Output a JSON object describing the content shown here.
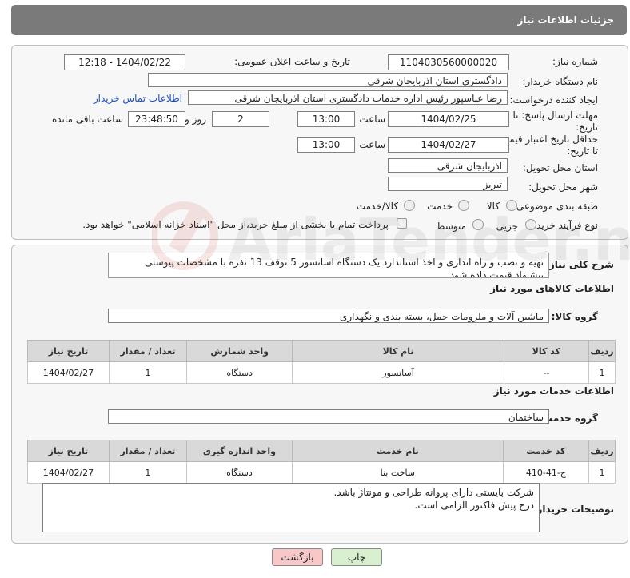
{
  "header": {
    "title": "جزئیات اطلاعات نیاز"
  },
  "fields": {
    "need_number_label": "شماره نیاز:",
    "need_number": "1104030560000020",
    "announce_label": "تاریخ و ساعت اعلان عمومی:",
    "announce_value": "1404/02/22 - 12:18",
    "buyer_org_label": "نام دستگاه خریدار:",
    "buyer_org": "دادگستری استان اذربایجان شرقی",
    "creator_label": "ایجاد کننده درخواست:",
    "creator": "رضا عباسپور رئیس اداره خدمات دادگستری استان اذربایجان شرقی",
    "contact_link": "اطلاعات تماس خریدار",
    "deadline_label": "مهلت ارسال پاسخ: تا تاریخ:",
    "deadline_date": "1404/02/25",
    "time_label": "ساعت",
    "deadline_time": "13:00",
    "days_value": "2",
    "days_label": "روز و",
    "remaining_time": "23:48:50",
    "remaining_label": "ساعت باقی مانده",
    "validity_label": "حداقل تاریخ اعتبار قیمت: تا تاریخ:",
    "validity_date": "1404/02/27",
    "validity_time": "13:00",
    "province_label": "استان محل تحویل:",
    "province": "آذربایجان شرقی",
    "city_label": "شهر محل تحویل:",
    "city": "تبریز",
    "category_label": "طبقه بندی موضوعی:",
    "category_options": [
      "کالا",
      "خدمت",
      "کالا/خدمت"
    ],
    "process_label": "نوع فرآیند خرید :",
    "process_options": [
      "جزیی",
      "متوسط"
    ],
    "payment_note": "پرداخت تمام یا بخشی از مبلغ خرید،از محل \"اسناد خزانه اسلامی\" خواهد بود."
  },
  "description": {
    "label": "شرح کلی نیاز:",
    "text": "تهیه و نصب و راه اندازی و اخذ استاندارد یک دستگاه آسانسور 5 توقف 13 نفره با مشخصات پیوستی پیشنهاد قیمت داده شود."
  },
  "goods": {
    "section_title": "اطلاعات کالاهای مورد نیاز",
    "group_label": "گروه کالا:",
    "group_value": "ماشین آلات و ملزومات حمل، بسته بندی و نگهداری",
    "columns": [
      "ردیف",
      "کد کالا",
      "نام کالا",
      "واحد شمارش",
      "تعداد / مقدار",
      "تاریخ نیاز"
    ],
    "rows": [
      [
        "1",
        "--",
        "آسانسور",
        "دستگاه",
        "1",
        "1404/02/27"
      ]
    ]
  },
  "services": {
    "section_title": "اطلاعات خدمات مورد نیاز",
    "group_label": "گروه خدمت:",
    "group_value": "ساختمان",
    "columns": [
      "ردیف",
      "کد خدمت",
      "نام خدمت",
      "واحد اندازه گیری",
      "تعداد / مقدار",
      "تاریخ نیاز"
    ],
    "rows": [
      [
        "1",
        "ج-41-410",
        "ساخت بنا",
        "دستگاه",
        "1",
        "1404/02/27"
      ]
    ]
  },
  "buyer_notes": {
    "label": "توضیحات خریدار:",
    "line1": "شرکت بایستی دارای پروانه طراحی و مونتاژ باشد.",
    "line2": "درج پیش فاکتور الزامی است."
  },
  "buttons": {
    "print": "چاپ",
    "back": "بازگشت"
  },
  "colors": {
    "header_bg": "#7a7a7a",
    "link": "#1a50c8",
    "back_button": "#f8c8c8",
    "print_button": "#d8f0d0"
  }
}
